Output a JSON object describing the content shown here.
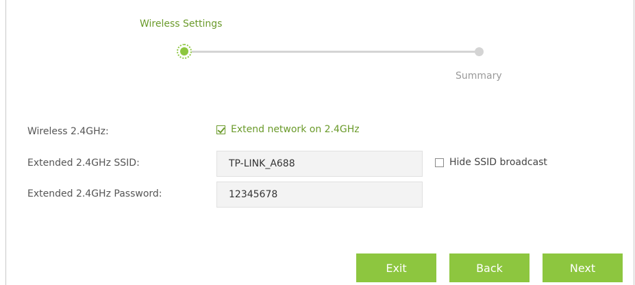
{
  "wizard": {
    "steps": [
      {
        "label": "Wireless Settings",
        "active": true
      },
      {
        "label": "Summary",
        "active": false
      }
    ]
  },
  "form": {
    "wireless": {
      "label": "Wireless 2.4GHz:",
      "extend_label": "Extend network on 2.4GHz",
      "extend_checked": true
    },
    "ssid": {
      "label": "Extended 2.4GHz SSID:",
      "value": "TP-LINK_A688",
      "hide_label": "Hide SSID broadcast",
      "hide_checked": false
    },
    "password": {
      "label": "Extended 2.4GHz Password:",
      "value": "12345678"
    }
  },
  "buttons": {
    "exit": "Exit",
    "back": "Back",
    "next": "Next"
  },
  "colors": {
    "accent": "#8dc63f",
    "accent_text": "#6a9a2a",
    "inactive": "#d4d4d4"
  },
  "icons": {
    "active_step": "active-step-dot-icon",
    "inactive_step": "inactive-step-dot-icon",
    "checkbox_checked": "checkbox-checked-icon",
    "checkbox_unchecked": "checkbox-unchecked-icon"
  }
}
